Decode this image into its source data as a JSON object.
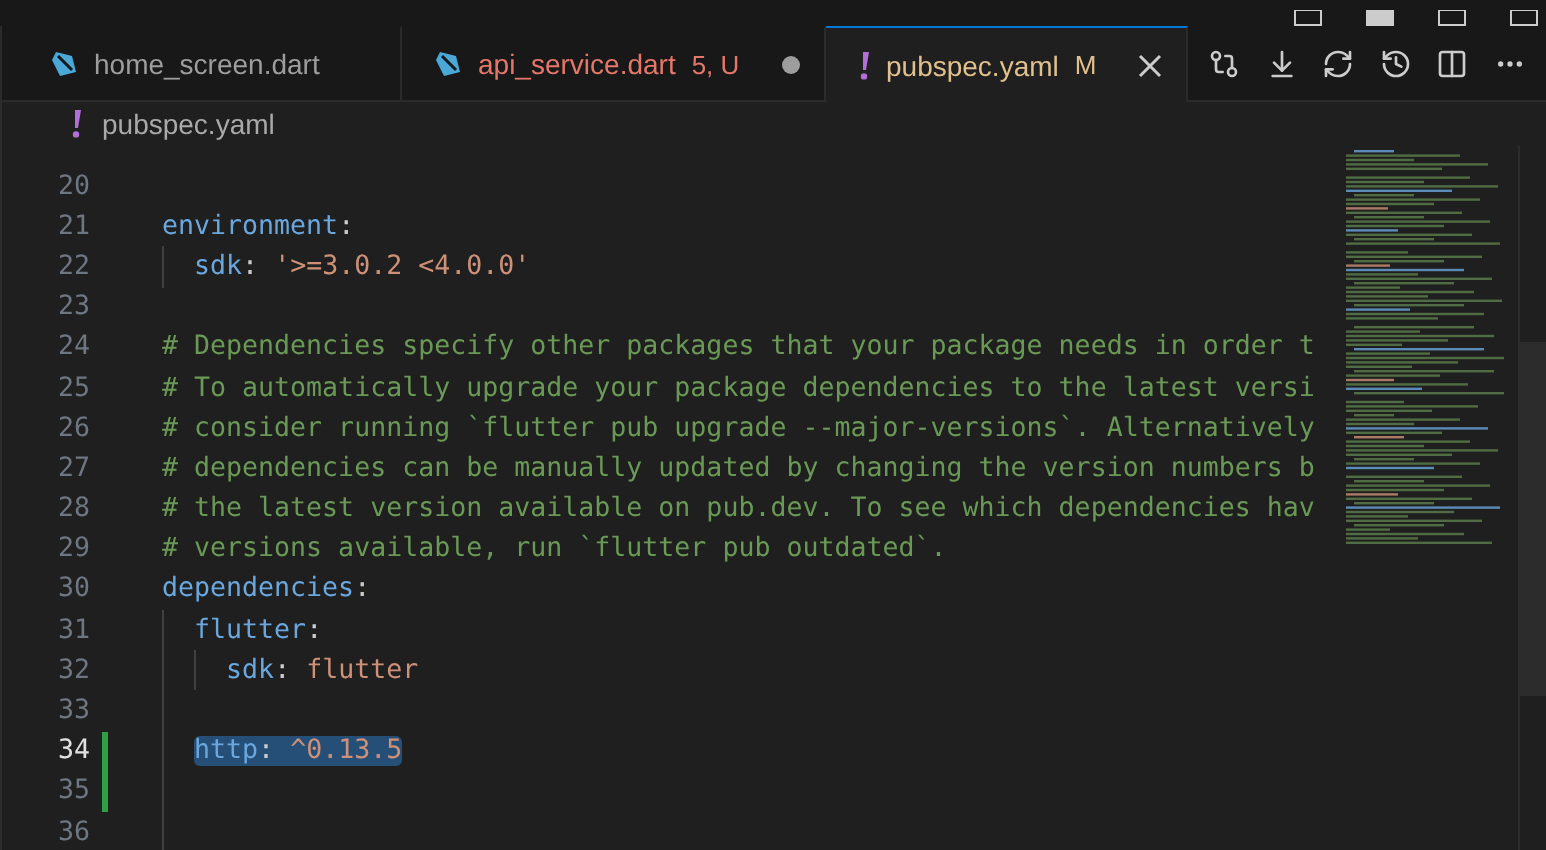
{
  "tabs": [
    {
      "label": "home_screen.dart",
      "kind": "dart",
      "color": "#9d9d9d",
      "dirty": false,
      "selected": false
    },
    {
      "label": "api_service.dart",
      "kind": "dart",
      "color": "#e4776a",
      "badge": "5, U",
      "dirty": true,
      "selected": false
    },
    {
      "label": "pubspec.yaml",
      "kind": "yaml",
      "color": "#e2c08d",
      "badge": "M",
      "selected": true
    }
  ],
  "breadcrumb": {
    "kind": "yaml",
    "label": "pubspec.yaml"
  },
  "lines": [
    {
      "number": "20",
      "current": false,
      "changed": false,
      "selected": false
    },
    {
      "number": "21",
      "current": false,
      "changed": false,
      "selected": false,
      "tokens": [
        {
          "kind": "key",
          "text": "environment"
        },
        {
          "kind": "punct",
          "text": ":"
        }
      ],
      "children": [
        {
          "number": "22",
          "current": false,
          "changed": false,
          "selected": false,
          "tokens": [
            {
              "kind": "key",
              "text": "sdk"
            },
            {
              "kind": "punct",
              "text": ": "
            },
            {
              "kind": "string",
              "text": "'>=3.0.2 <4.0.0'"
            }
          ]
        }
      ]
    },
    {
      "number": "23",
      "current": false,
      "changed": false,
      "selected": false
    },
    {
      "number": "24",
      "current": false,
      "changed": false,
      "selected": false,
      "tokens": [
        {
          "kind": "comment",
          "text": "# Dependencies specify other packages that your package needs in order t"
        }
      ]
    },
    {
      "number": "25",
      "current": false,
      "changed": false,
      "selected": false,
      "tokens": [
        {
          "kind": "comment",
          "text": "# To automatically upgrade your package dependencies to the latest versi"
        }
      ]
    },
    {
      "number": "26",
      "current": false,
      "changed": false,
      "selected": false,
      "tokens": [
        {
          "kind": "comment",
          "text": "# consider running `flutter pub upgrade --major-versions`. Alternatively"
        }
      ]
    },
    {
      "number": "27",
      "current": false,
      "changed": false,
      "selected": false,
      "tokens": [
        {
          "kind": "comment",
          "text": "# dependencies can be manually updated by changing the version numbers b"
        }
      ]
    },
    {
      "number": "28",
      "current": false,
      "changed": false,
      "selected": false,
      "tokens": [
        {
          "kind": "comment",
          "text": "# the latest version available on pub.dev. To see which dependencies hav"
        }
      ]
    },
    {
      "number": "29",
      "current": false,
      "changed": false,
      "selected": false,
      "tokens": [
        {
          "kind": "comment",
          "text": "# versions available, run `flutter pub outdated`."
        }
      ]
    },
    {
      "number": "30",
      "current": false,
      "changed": false,
      "selected": false,
      "tokens": [
        {
          "kind": "key",
          "text": "dependencies"
        },
        {
          "kind": "punct",
          "text": ":"
        }
      ],
      "children": [
        {
          "number": "31",
          "current": false,
          "changed": false,
          "selected": false,
          "tokens": [
            {
              "kind": "key",
              "text": "flutter"
            },
            {
              "kind": "punct",
              "text": ":"
            }
          ],
          "children": [
            {
              "number": "32",
              "current": false,
              "changed": false,
              "selected": false,
              "tokens": [
                {
                  "kind": "key",
                  "text": "sdk"
                },
                {
                  "kind": "punct",
                  "text": ": "
                },
                {
                  "kind": "string",
                  "text": "flutter"
                }
              ]
            }
          ]
        },
        {
          "number": "33",
          "current": false,
          "changed": false,
          "selected": false
        },
        {
          "number": "34",
          "current": true,
          "changed": true,
          "selected": true,
          "tokens": [
            {
              "kind": "key",
              "text": "http"
            },
            {
              "kind": "punct",
              "text": ": "
            },
            {
              "kind": "string",
              "text": "^0.13.5"
            }
          ]
        },
        {
          "number": "35",
          "current": false,
          "changed": true,
          "selected": false
        },
        {
          "number": "36",
          "current": false,
          "changed": false,
          "selected": false
        }
      ]
    }
  ]
}
